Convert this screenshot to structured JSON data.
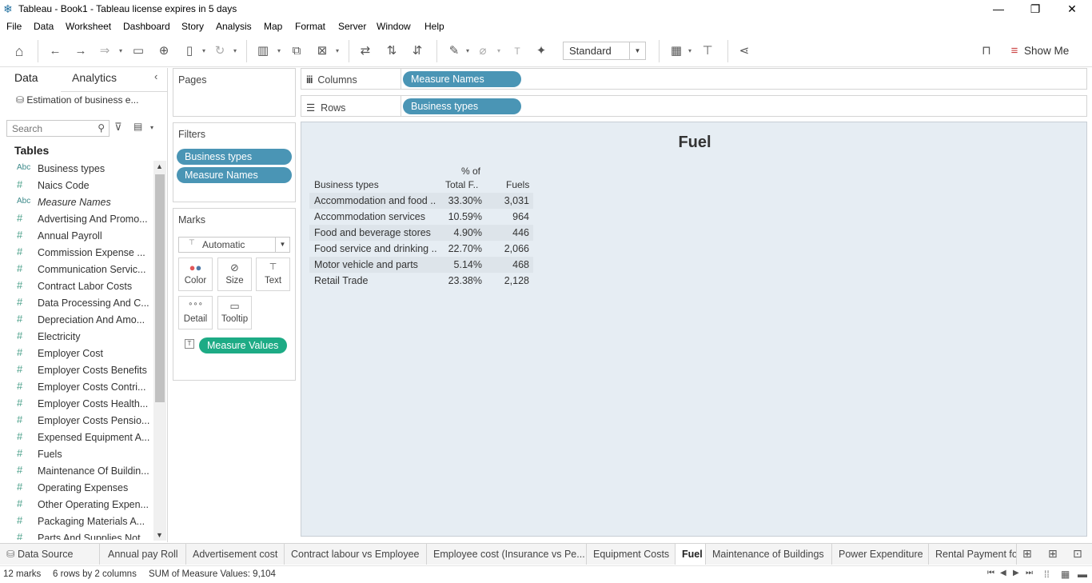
{
  "window": {
    "title": "Tableau - Book1 - Tableau license expires in 5 days",
    "minimize": "—",
    "restore": "❐",
    "close": "✕"
  },
  "menu": [
    "File",
    "Data",
    "Worksheet",
    "Dashboard",
    "Story",
    "Analysis",
    "Map",
    "Format",
    "Server",
    "Window",
    "Help"
  ],
  "toolbar": {
    "fit_mode": "Standard",
    "show_me_label": "Show Me"
  },
  "data_pane": {
    "tab_data": "Data",
    "tab_analytics": "Analytics",
    "data_source": "Estimation of business e...",
    "search_placeholder": "Search",
    "tables_heading": "Tables",
    "fields": [
      {
        "type": "abc",
        "name": "Business types",
        "italic": false
      },
      {
        "type": "num",
        "name": "Naics Code",
        "italic": false
      },
      {
        "type": "abc",
        "name": "Measure Names",
        "italic": true
      },
      {
        "type": "num",
        "name": "Advertising And Promo...",
        "italic": false
      },
      {
        "type": "num",
        "name": "Annual Payroll",
        "italic": false
      },
      {
        "type": "num",
        "name": "Commission Expense ...",
        "italic": false
      },
      {
        "type": "num",
        "name": "Communication Servic...",
        "italic": false
      },
      {
        "type": "num",
        "name": "Contract Labor Costs",
        "italic": false
      },
      {
        "type": "num",
        "name": "Data Processing And C...",
        "italic": false
      },
      {
        "type": "num",
        "name": "Depreciation And Amo...",
        "italic": false
      },
      {
        "type": "num",
        "name": "Electricity",
        "italic": false
      },
      {
        "type": "num",
        "name": "Employer Cost",
        "italic": false
      },
      {
        "type": "num",
        "name": "Employer Costs Benefits",
        "italic": false
      },
      {
        "type": "num",
        "name": "Employer Costs Contri...",
        "italic": false
      },
      {
        "type": "num",
        "name": "Employer Costs Health...",
        "italic": false
      },
      {
        "type": "num",
        "name": "Employer Costs Pensio...",
        "italic": false
      },
      {
        "type": "num",
        "name": "Expensed Equipment A...",
        "italic": false
      },
      {
        "type": "num",
        "name": "Fuels",
        "italic": false
      },
      {
        "type": "num",
        "name": "Maintenance Of Buildin...",
        "italic": false
      },
      {
        "type": "num",
        "name": "Operating Expenses",
        "italic": false
      },
      {
        "type": "num",
        "name": "Other Operating Expen...",
        "italic": false
      },
      {
        "type": "num",
        "name": "Packaging Materials A...",
        "italic": false
      },
      {
        "type": "num",
        "name": "Parts And Supplies Not...",
        "italic": false
      }
    ],
    "icon_abc": "Abc",
    "icon_num": "#"
  },
  "cards": {
    "pages_title": "Pages",
    "filters_title": "Filters",
    "filters": [
      "Business types",
      "Measure Names"
    ],
    "marks_title": "Marks",
    "marks_type": "Automatic",
    "mark_buttons": {
      "color": "Color",
      "size": "Size",
      "text": "Text",
      "detail": "Detail",
      "tooltip": "Tooltip"
    },
    "marks_pill": "Measure Values"
  },
  "shelves": {
    "columns_label": "Columns",
    "columns_pill": "Measure Names",
    "rows_label": "Rows",
    "rows_pill": "Business types"
  },
  "viz": {
    "title": "Fuel",
    "col_header_1": "Business types",
    "col_header_2_line1": "% of",
    "col_header_2_line2": "Total F..",
    "col_header_3": "Fuels",
    "rows": [
      {
        "business": "Accommodation and food ..",
        "pct": "33.30%",
        "fuels": "3,031"
      },
      {
        "business": "Accommodation services",
        "pct": "10.59%",
        "fuels": "964"
      },
      {
        "business": "Food and beverage stores",
        "pct": "4.90%",
        "fuels": "446"
      },
      {
        "business": "Food service and drinking ..",
        "pct": "22.70%",
        "fuels": "2,066"
      },
      {
        "business": "Motor vehicle and parts",
        "pct": "5.14%",
        "fuels": "468"
      },
      {
        "business": "Retail Trade",
        "pct": "23.38%",
        "fuels": "2,128"
      }
    ]
  },
  "sheet_tabs": {
    "data_source": "Data Source",
    "tabs": [
      {
        "label": "Annual pay Roll",
        "active": false
      },
      {
        "label": "Advertisement cost",
        "active": false
      },
      {
        "label": "Contract labour vs Employee",
        "active": false
      },
      {
        "label": "Employee cost (Insurance vs Pe...",
        "active": false
      },
      {
        "label": "Equipment Costs",
        "active": false
      },
      {
        "label": "Fuel",
        "active": true
      },
      {
        "label": "Maintenance of Buildings",
        "active": false
      },
      {
        "label": "Power Expenditure",
        "active": false
      },
      {
        "label": "Rental Payment fo",
        "active": false
      }
    ]
  },
  "status": {
    "marks": "12 marks",
    "dims": "6 rows by 2 columns",
    "sum": "SUM of Measure Values: 9,104"
  },
  "colors": {
    "pill_blue": "#4a95b5",
    "pill_green": "#1dab85",
    "viz_background": "#e6edf3"
  }
}
